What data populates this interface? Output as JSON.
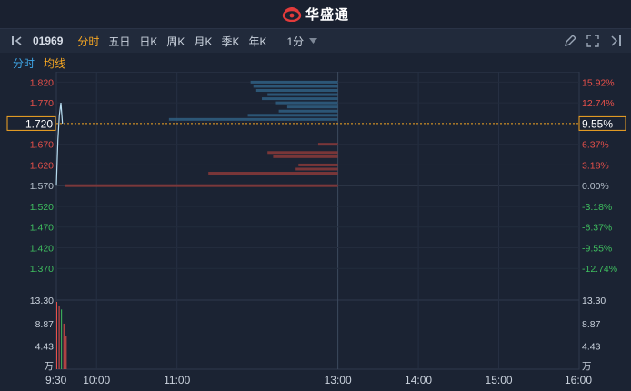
{
  "app": {
    "title": "华盛通"
  },
  "toolbar": {
    "code": "01969",
    "tabs": [
      "分时",
      "五日",
      "日K",
      "周K",
      "月K",
      "季K",
      "年K"
    ],
    "active_tab": "分时",
    "interval": "1分"
  },
  "subbar": {
    "mode": "分时",
    "avg_line": "均线"
  },
  "price_axis": {
    "left": [
      "1.820",
      "1.770",
      "1.670",
      "1.620",
      "1.570",
      "1.520",
      "1.470",
      "1.420",
      "1.370"
    ],
    "right": [
      "15.92%",
      "12.74%",
      "6.37%",
      "3.18%",
      "0.00%",
      "-3.18%",
      "-6.37%",
      "-9.55%",
      "-12.74%"
    ],
    "current_price": "1.720",
    "current_pct": "9.55%"
  },
  "volume_axis": {
    "left": [
      "13.30",
      "8.87",
      "4.43",
      "万"
    ],
    "right": [
      "13.30",
      "8.87",
      "4.43",
      "万"
    ]
  },
  "time_axis": [
    "9:30",
    "10:00",
    "11:00",
    "13:00",
    "14:00",
    "15:00",
    "16:00"
  ],
  "colors": {
    "up": "#e8504a",
    "down": "#3fbf5f",
    "neutral": "#b6c0cc",
    "accent": "#f5a623",
    "line": "#b7dcf0"
  },
  "chart_data": {
    "type": "line",
    "series": [
      {
        "name": "分时",
        "x": [
          "9:30",
          "9:31",
          "9:32",
          "9:33",
          "9:34"
        ],
        "values": [
          1.57,
          1.68,
          1.74,
          1.77,
          1.72
        ]
      }
    ],
    "volume": {
      "x": [
        "9:30",
        "9:31",
        "9:32",
        "9:33",
        "9:34"
      ],
      "values": [
        13.3,
        12.5,
        11.8,
        9.0,
        6.5
      ]
    },
    "ylim": [
      1.32,
      1.845
    ],
    "prev_close": 1.57,
    "order_book": {
      "ask_levels": [
        1.82,
        1.81,
        1.8,
        1.79,
        1.78,
        1.77,
        1.76,
        1.75,
        1.74,
        1.73
      ],
      "ask_sizes": [
        0.31,
        0.3,
        0.29,
        0.25,
        0.27,
        0.22,
        0.18,
        0.21,
        0.32,
        0.6
      ],
      "bid_levels": [
        1.67,
        1.65,
        1.64,
        1.62,
        1.61,
        1.6,
        1.57
      ],
      "bid_sizes": [
        0.07,
        0.25,
        0.23,
        0.14,
        0.15,
        0.46,
        0.97
      ]
    }
  }
}
